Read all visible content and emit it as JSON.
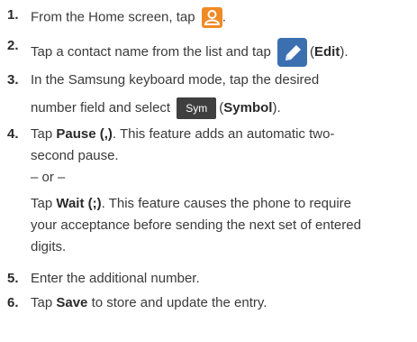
{
  "steps": [
    {
      "num": "1.",
      "pre": "From the Home screen, tap",
      "icon": "contacts-icon",
      "post": "."
    },
    {
      "num": "2.",
      "pre": "Tap a contact name from the list and tap",
      "icon": "edit-pencil-icon",
      "post_open": "(",
      "bold": "Edit",
      "post_close": ")."
    },
    {
      "num": "3.",
      "line1": "In the Samsung keyboard mode, tap the desired",
      "line2_pre": "number field and select",
      "sym_label": "Sym",
      "post_open": "(",
      "bold": "Symbol",
      "post_close": ")."
    },
    {
      "num": "4.",
      "pre": "Tap",
      "bold": "Pause (,)",
      "post": ". This feature adds an automatic two-",
      "line2": "second pause.",
      "or": "– or –",
      "alt_pre": "Tap",
      "alt_bold": "Wait (;)",
      "alt_post": ". This feature causes the phone to require",
      "alt_line2": "your acceptance before sending the next set of entered",
      "alt_line3": "digits."
    },
    {
      "num": "5.",
      "text": "Enter the additional number."
    },
    {
      "num": "6.",
      "pre": "Tap",
      "bold": "Save",
      "post": "to store and update the entry."
    }
  ],
  "colors": {
    "contact_icon_bg": "#f08a25",
    "edit_icon_bg": "#3b6fb0",
    "sym_bg": "#3f3f3f"
  }
}
